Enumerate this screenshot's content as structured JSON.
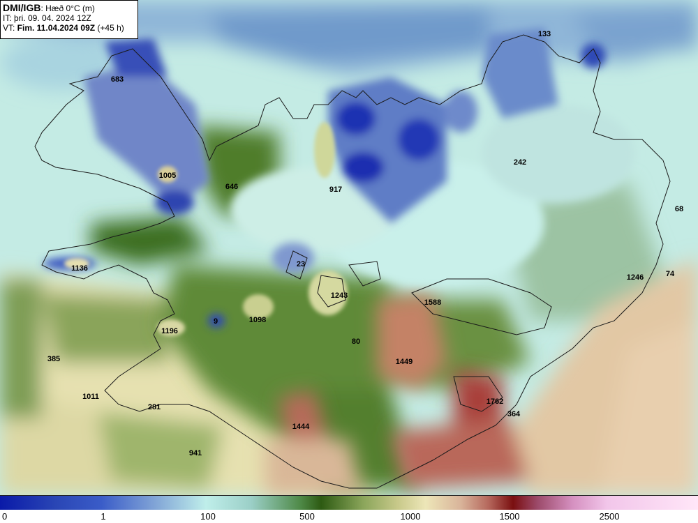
{
  "header": {
    "source": "DMI/IGB",
    "variable": ": Hæð 0°C (m)",
    "issue_time": "IT: þri. 09. 04. 2024 12Z",
    "valid_prefix": "VT: ",
    "valid_time": "Fim. 11.04.2024 09Z",
    "lead_time": " (+45 h)"
  },
  "colors": {
    "c0": "#0a1aa8",
    "c1": "#3a5cc8",
    "c100": "#bfeeea",
    "c500": "#2d5a12",
    "c1000": "#ede6b8",
    "c1500": "#7a0f10",
    "c2500": "#ffe6f8",
    "coast": "#1a1a1a"
  },
  "spot_values": [
    {
      "label": "133"
    },
    {
      "label": "683"
    },
    {
      "label": "242"
    },
    {
      "label": "1005"
    },
    {
      "label": "646"
    },
    {
      "label": "917"
    },
    {
      "label": "68"
    },
    {
      "label": "1136"
    },
    {
      "label": "23"
    },
    {
      "label": "1246"
    },
    {
      "label": "74"
    },
    {
      "label": "1243"
    },
    {
      "label": "1588"
    },
    {
      "label": "1196"
    },
    {
      "label": "9"
    },
    {
      "label": "1098"
    },
    {
      "label": "80"
    },
    {
      "label": "385"
    },
    {
      "label": "1449"
    },
    {
      "label": "1011"
    },
    {
      "label": "1762"
    },
    {
      "label": "281"
    },
    {
      "label": "364"
    },
    {
      "label": "1444"
    },
    {
      "label": "941"
    }
  ],
  "colorbar": {
    "ticks": [
      "0",
      "1",
      "100",
      "500",
      "1000",
      "1500",
      "2500"
    ]
  }
}
